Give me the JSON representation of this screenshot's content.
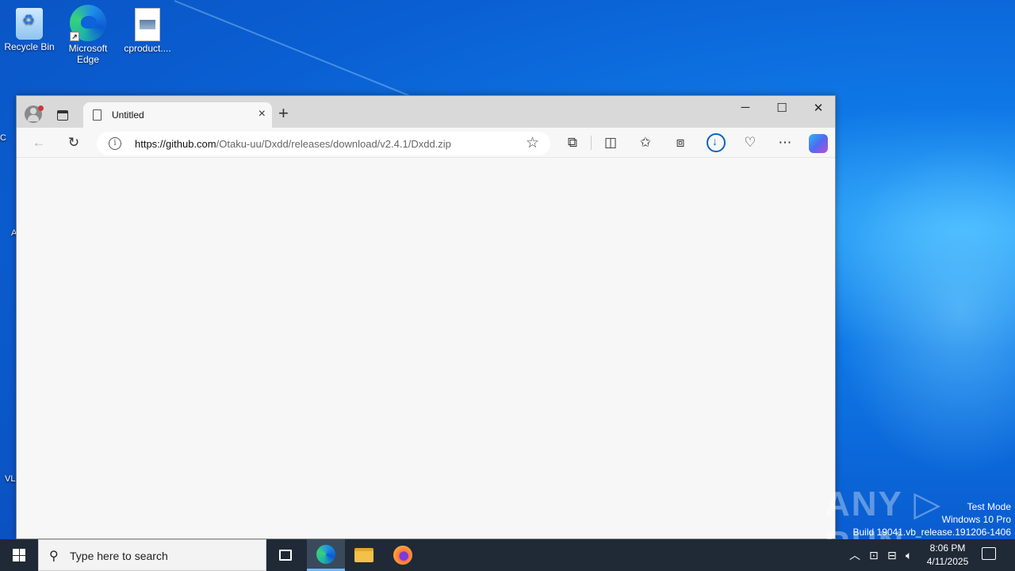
{
  "desktop": {
    "icons": [
      {
        "label": "Recycle Bin"
      },
      {
        "label": "Microsoft Edge"
      },
      {
        "label": "cproduct...."
      }
    ],
    "partial_left_labels": [
      "C",
      "A",
      "VL"
    ]
  },
  "browser": {
    "tab_title": "Untitled",
    "url_host": "https://github.com",
    "url_path": "/Otaku-uu/Dxdd/releases/download/v2.4.1/Dxdd.zip",
    "window_controls": {
      "minimize": "─",
      "maximize": "☐",
      "close": "✕"
    }
  },
  "watermark": {
    "brand": "ANY ▷ RUN",
    "test_mode": "Test Mode",
    "os": "Windows 10 Pro",
    "build": "Build 19041.vb_release.191206-1406"
  },
  "taskbar": {
    "search_placeholder": "Type here to search",
    "time": "8:06 PM",
    "date": "4/11/2025"
  },
  "colors": {
    "accent": "#0d63c4",
    "taskbar": "#1f2a36"
  }
}
